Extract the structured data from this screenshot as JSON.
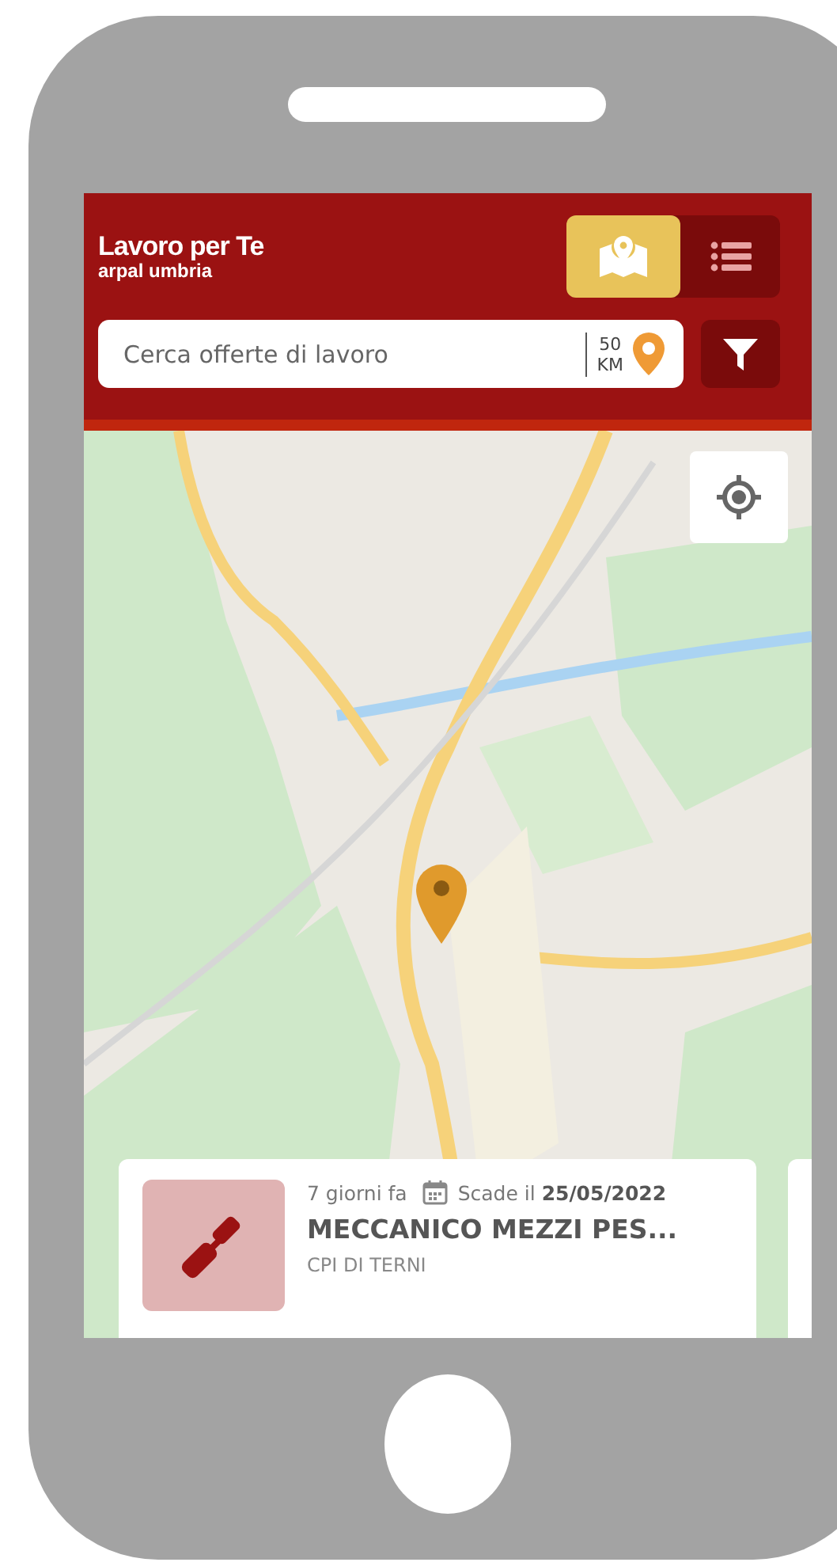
{
  "app": {
    "title": "Lavoro per Te",
    "subtitle": "arpal umbria"
  },
  "view_toggle": [
    {
      "kind": "map",
      "selected": true
    },
    {
      "kind": "list",
      "selected": false
    }
  ],
  "search": {
    "placeholder": "Cerca offerte di lavoro",
    "radius_value": "50",
    "radius_unit": "KM"
  },
  "job_cards": [
    {
      "posted": "7 giorni fa",
      "deadline": "Scade il **25/05/2022**",
      "title": "MECCANICO MEZZI PES...",
      "office": "CPI DI TERNI"
    }
  ]
}
